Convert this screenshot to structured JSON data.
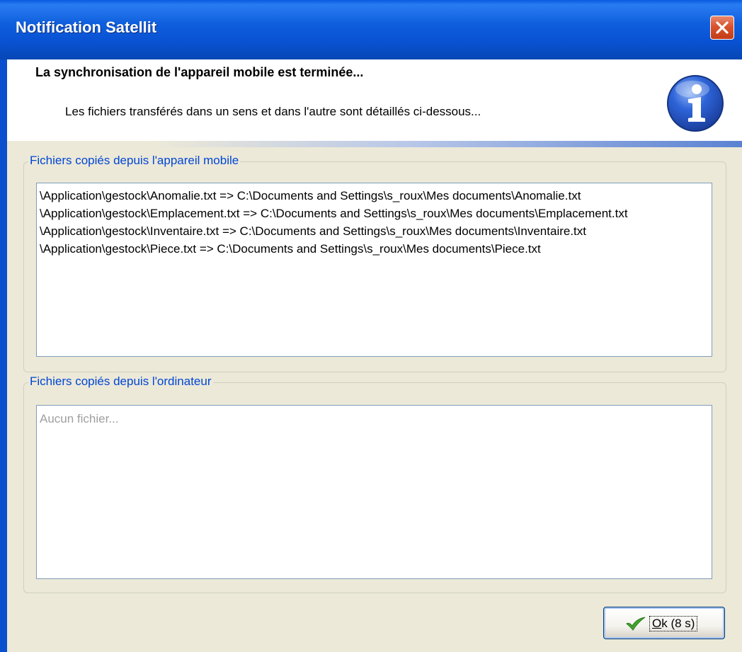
{
  "window": {
    "title": "Notification Satellit"
  },
  "header": {
    "heading": "La synchronisation de l'appareil mobile est terminée...",
    "subtext": "Les fichiers transférés dans un sens et dans l'autre sont détaillés ci-dessous..."
  },
  "from_mobile": {
    "label": "Fichiers copiés depuis l'appareil mobile",
    "files": [
      "\\Application\\gestock\\Anomalie.txt => C:\\Documents and Settings\\s_roux\\Mes documents\\Anomalie.txt",
      "\\Application\\gestock\\Emplacement.txt => C:\\Documents and Settings\\s_roux\\Mes documents\\Emplacement.txt",
      "\\Application\\gestock\\Inventaire.txt => C:\\Documents and Settings\\s_roux\\Mes documents\\Inventaire.txt",
      "\\Application\\gestock\\Piece.txt => C:\\Documents and Settings\\s_roux\\Mes documents\\Piece.txt"
    ]
  },
  "from_computer": {
    "label": "Fichiers copiés depuis l'ordinateur",
    "placeholder": "Aucun fichier..."
  },
  "ok_button": {
    "mnemonic": "O",
    "rest": "k (8 s)"
  },
  "icons": {
    "close": "close-icon",
    "info": "info-icon",
    "check": "check-icon"
  },
  "colors": {
    "titlebar": "#0A5BE0",
    "group_label": "#0046D5",
    "window_bg": "#ECE9D8",
    "check": "#3FA52B"
  }
}
